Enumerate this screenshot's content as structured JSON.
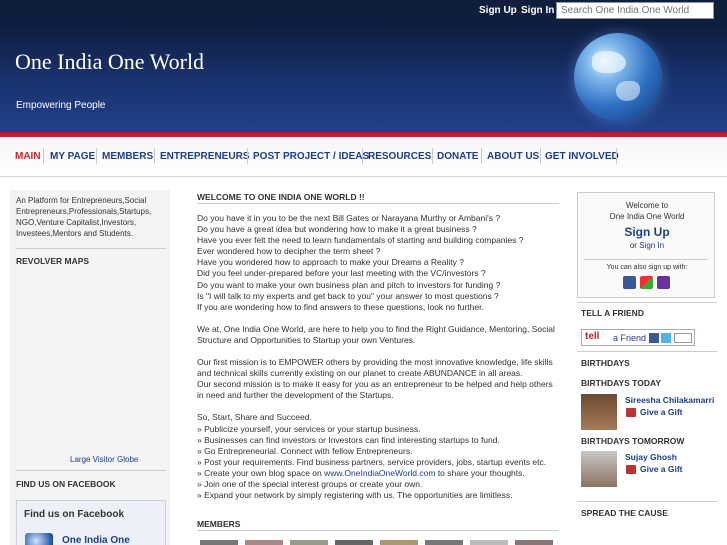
{
  "topbar": {
    "sign_up": "Sign Up",
    "sign_in": "Sign In",
    "search_placeholder": "Search One India One World"
  },
  "header": {
    "title": "One India One World",
    "tagline": "Empowering People"
  },
  "nav": {
    "items": [
      "MAIN",
      "MY PAGE",
      "MEMBERS",
      "ENTREPRENEURS",
      "POST PROJECT / IDEAS",
      "RESOURCES",
      "DONATE",
      "ABOUT US",
      "GET INVOLVED"
    ],
    "active": "MAIN"
  },
  "left": {
    "intro": "An Platform for Entrepreneurs,Social Entrepreneurs,Professionals,Startups, NGO,Venture Capitalist,Investors, Investees,Mentors and Students.",
    "revolver_title": "REVOLVER MAPS",
    "visitor_globe": "Large Visitor Globe",
    "facebook_title": "FIND US ON FACEBOOK",
    "fb_box_title": "Find us on Facebook",
    "fb_page": "One India One"
  },
  "main": {
    "welcome_title": "WELCOME TO ONE INDIA ONE WORLD !!",
    "lines": [
      "Do you have it in you to be the next Bill Gates or Narayana Murthy or Ambani's ?",
      "Do you have a great idea but wondering how to make it a great business ?",
      "Have you ever felt the need to learn fundamentals of starting and building companies ?",
      "Ever wondered how to decipher the term sheet ?",
      "Have you wondered how to approach to make your Dreams a Reality ?",
      "Did you feel under-prepared before your last meeting with the VC/investors ?",
      "Do you want to make your own business plan and pitch to investors for funding ?",
      "Is \"I will talk to my experts and get back to you\" your answer to most questions ?",
      "If you are wondering how to find answers to these questions, look no further."
    ],
    "para2": "We at, One India One World, are here to help you to find the Right Guidance, Mentoring, Social Structure and Opportunities to Startup your own Ventures.",
    "para3": "Our first mission is to EMPOWER others by providing the most innovative knowledge, life skills and technical skills currently existing on our planet to create ABUNDANCE in all areas.",
    "para4": "Our second mission is to make it easy for you as an entrepreneur to be helped and help others in need and further the development of the Startups.",
    "para5_title": "So, Start, Share and Succeed.",
    "bullets": [
      "» Publicize yourself, your services or your startup business.",
      "» Businesses can find investors or Investors can find interesting startups to fund.",
      "» Go Entrepreneurial. Connect with fellow Entrepreneurs.",
      "» Post your requirements. Find business partners, service providers, jobs, startup events etc."
    ],
    "bullet_blog_pre": "» Create your own blog space on ",
    "bullet_blog_link": "www.OneIndiaOneWorld.com",
    "bullet_blog_post": " to share your thoughts.",
    "bullets2": [
      "» Join one of the special interest groups or create your own.",
      "» Expand your network by simply registering with us. The opportunities are limitless."
    ],
    "members_title": "MEMBERS"
  },
  "right": {
    "welcome_to": "Welcome to",
    "site_name": "One India One World",
    "sign_up": "Sign Up",
    "or": "or",
    "sign_in": "Sign In",
    "also_sign_up": "You can also sign up with:",
    "tell_title": "TELL A FRIEND",
    "tell_a": "tell",
    "tell_friend": "a Friend",
    "birthdays_title": "BIRTHDAYS",
    "today_title": "BIRTHDAYS TODAY",
    "today_name": "Sireesha Chilakamarri",
    "gift_label": "Give a Gift",
    "tomorrow_title": "BIRTHDAYS TOMORROW",
    "tomorrow_name": "Sujay Ghosh",
    "spread_title": "SPREAD THE CAUSE"
  },
  "colors": {
    "nav_text": "#1c3f8a",
    "nav_active": "#c22b2b",
    "header_bg": "#1a3370",
    "red_rule": "#b7272b"
  }
}
